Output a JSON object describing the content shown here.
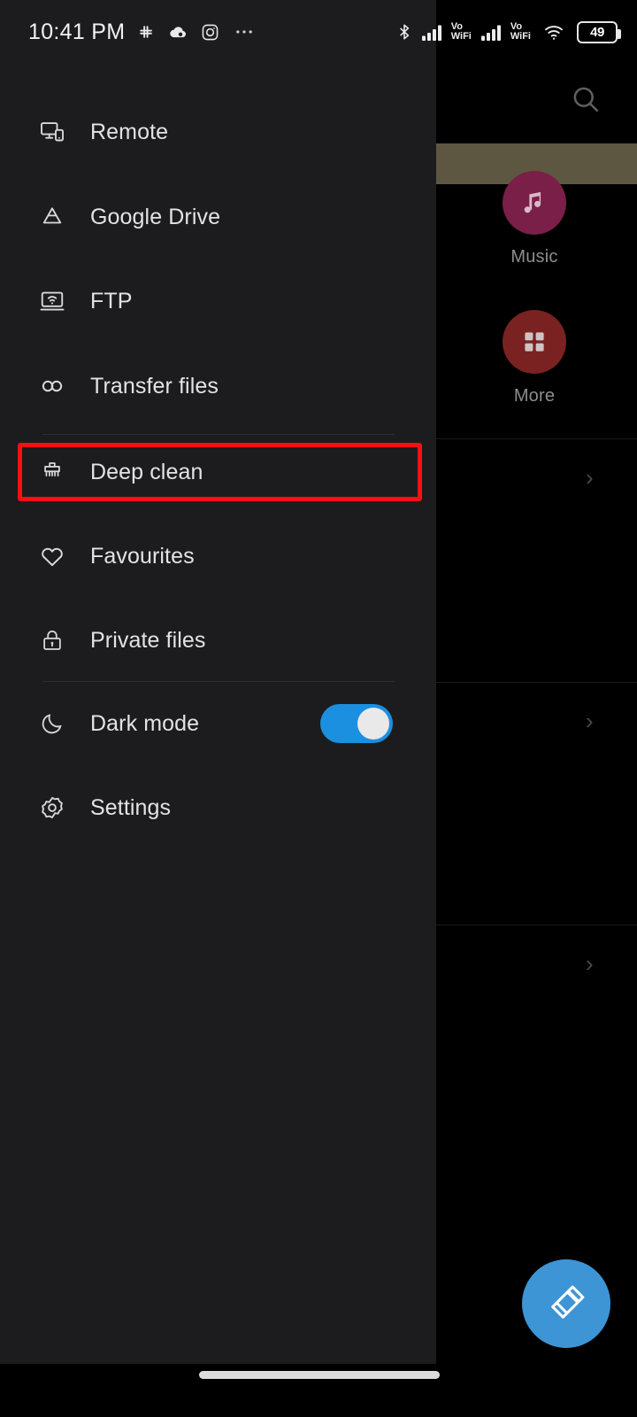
{
  "status_bar": {
    "time": "10:41 PM",
    "left_icons": [
      "slack-icon",
      "cloud-icon",
      "instagram-icon",
      "more-dots-icon"
    ],
    "right_icons": [
      "bluetooth-icon",
      "signal-bars-sim1-icon",
      "volte-vowifi-1-icon",
      "signal-bars-sim2-icon",
      "volte-vowifi-2-icon",
      "wifi-icon",
      "battery-icon"
    ],
    "volte_label_top": "Vo",
    "volte_label_bottom": "WiFi",
    "battery_level": "49"
  },
  "drawer": {
    "items": [
      {
        "label": "Remote",
        "icon": "remote-devices-icon"
      },
      {
        "label": "Google Drive",
        "icon": "google-drive-icon"
      },
      {
        "label": "FTP",
        "icon": "ftp-wifi-icon"
      },
      {
        "label": "Transfer files",
        "icon": "transfer-infinity-icon"
      },
      {
        "label": "Deep clean",
        "icon": "brush-icon"
      },
      {
        "label": "Favourites",
        "icon": "heart-icon"
      },
      {
        "label": "Private files",
        "icon": "lock-icon"
      },
      {
        "label": "Dark mode",
        "icon": "moon-icon"
      },
      {
        "label": "Settings",
        "icon": "gear-icon"
      }
    ],
    "dark_mode_toggle": {
      "state": "on",
      "track_color": "#1b8fe0",
      "knob_color": "#e9e9e9"
    },
    "highlight": {
      "target": "Deep clean",
      "color": "#fb0f12"
    }
  },
  "background": {
    "search_icon": "search-icon",
    "tiles": [
      {
        "label": "Music",
        "icon": "music-note-icon",
        "color": "#7a1f48"
      },
      {
        "label": "More",
        "icon": "grid-apps-icon",
        "color": "#7a2222"
      }
    ],
    "list_chevrons": [
      "chevron-right-icon",
      "chevron-right-icon",
      "chevron-right-icon"
    ],
    "highlight_bar_color": "#5d5640"
  },
  "fab": {
    "icon": "brush-clean-icon",
    "color": "#3d95d6"
  },
  "navigation": {
    "gesture_bar": "home-gesture-bar"
  }
}
